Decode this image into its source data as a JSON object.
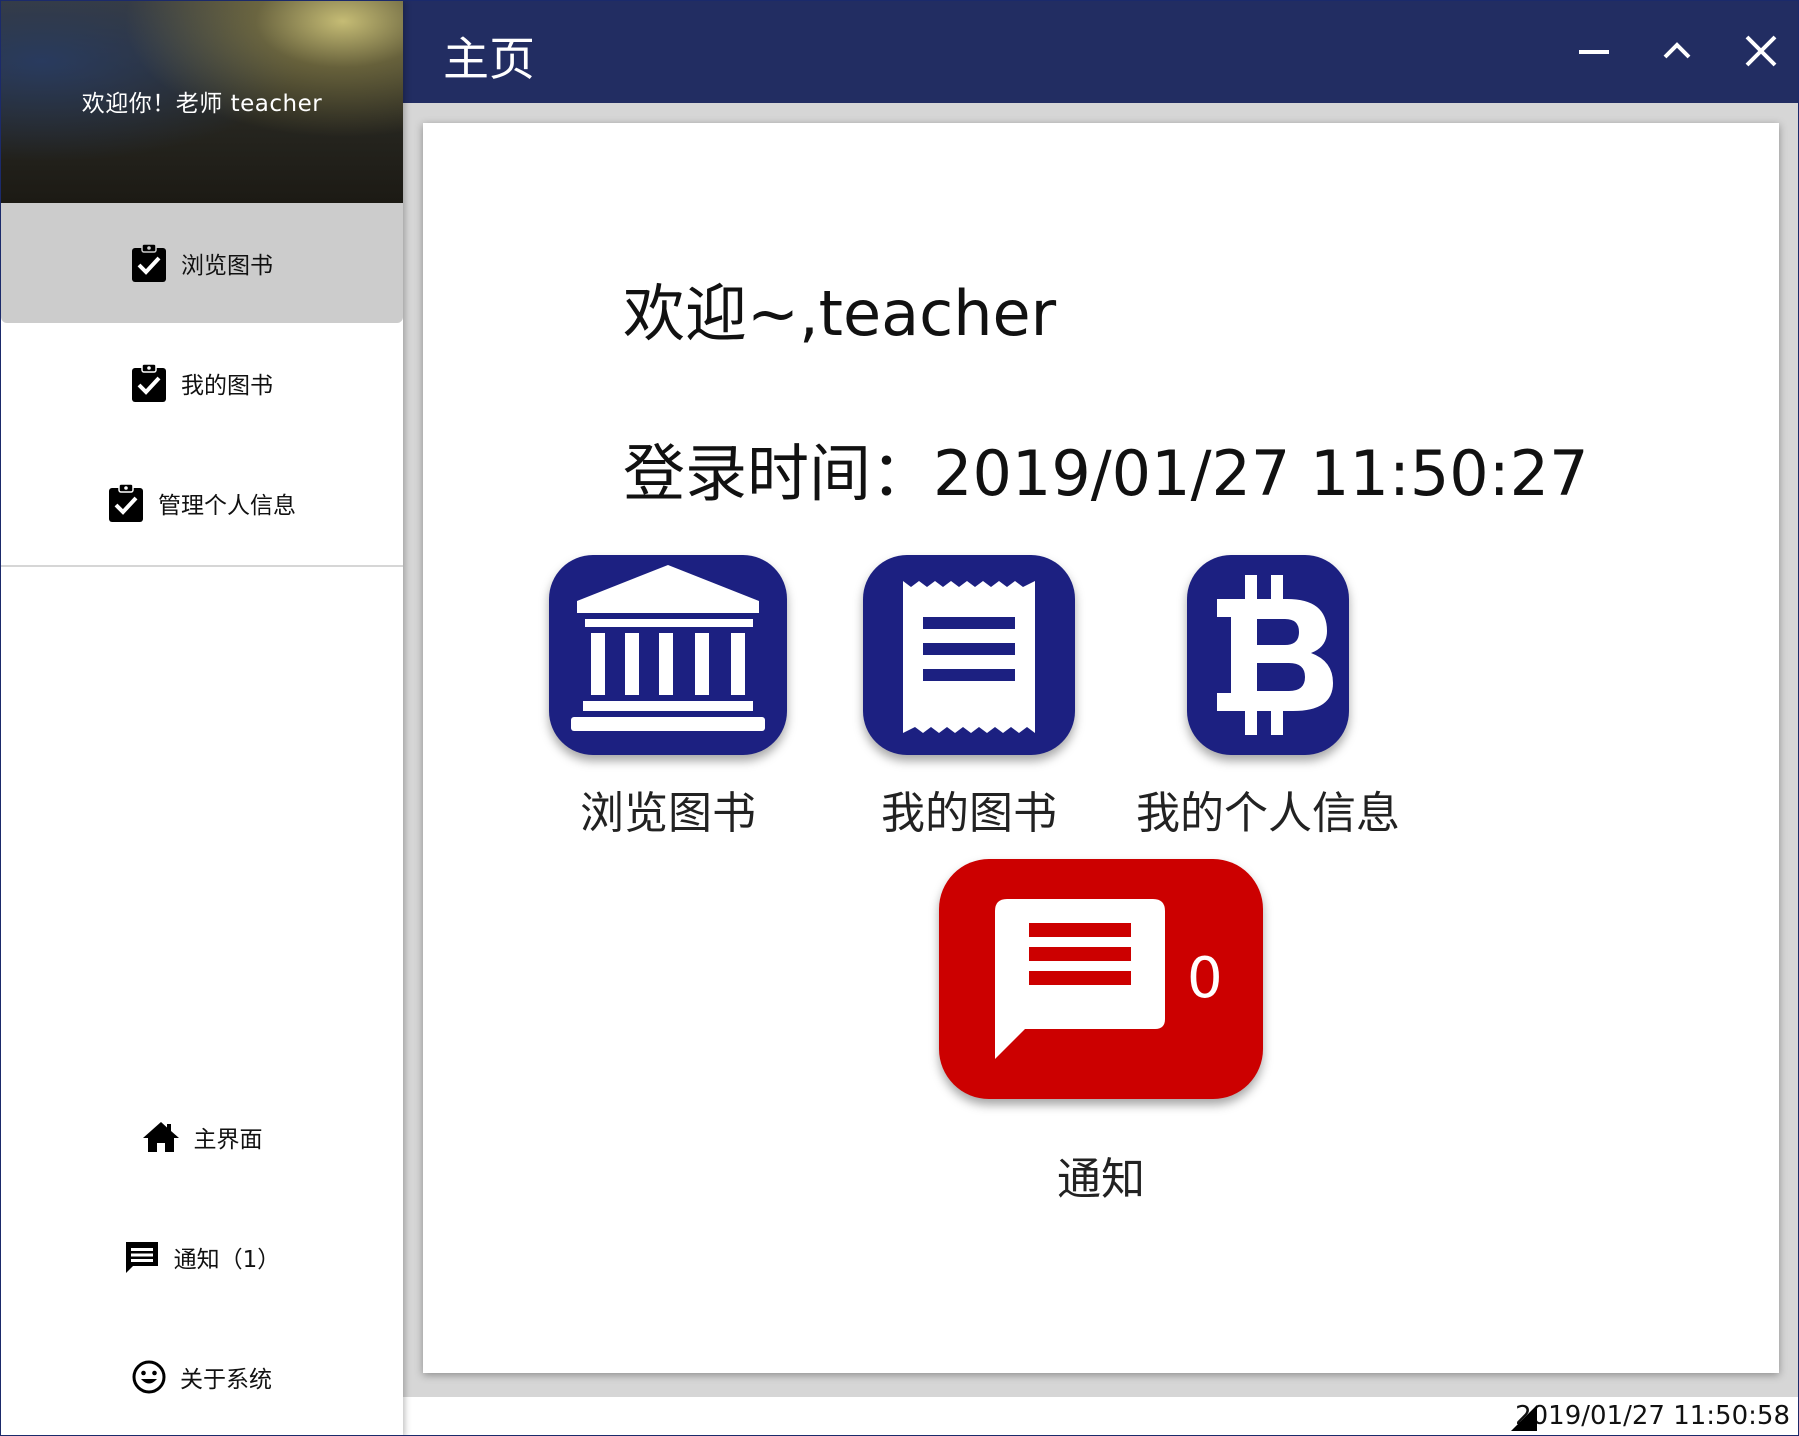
{
  "sidebar": {
    "greeting": "欢迎你！老师 teacher",
    "top_items": [
      {
        "label": "浏览图书",
        "icon": "clipboard-check-icon",
        "active": true
      },
      {
        "label": "我的图书",
        "icon": "clipboard-check-icon",
        "active": false
      },
      {
        "label": "管理个人信息",
        "icon": "clipboard-check-icon",
        "active": false
      }
    ],
    "bottom_items": [
      {
        "label": "主界面",
        "icon": "home-icon"
      },
      {
        "label": "通知（1）",
        "icon": "message-icon"
      },
      {
        "label": "关于系统",
        "icon": "smiley-icon"
      }
    ]
  },
  "titlebar": {
    "title": "主页",
    "buttons": [
      "minimize-icon",
      "chevron-up-icon",
      "close-icon"
    ]
  },
  "main": {
    "welcome": "欢迎~,teacher",
    "login_time": "登录时间：2019/01/27 11:50:27",
    "tiles": [
      {
        "label": "浏览图书",
        "icon": "bank-building-icon"
      },
      {
        "label": "我的图书",
        "icon": "receipt-icon"
      },
      {
        "label": "我的个人信息",
        "icon": "bitcoin-icon"
      }
    ],
    "notice": {
      "label": "通知",
      "count": "0",
      "icon": "message-icon"
    }
  },
  "statusbar": {
    "time": "2019/01/27 11:50:58"
  },
  "colors": {
    "titlebar": "#222d62",
    "tile_blue": "#1c2081",
    "notice_red": "#cc0000",
    "active_nav": "#cccccc"
  }
}
